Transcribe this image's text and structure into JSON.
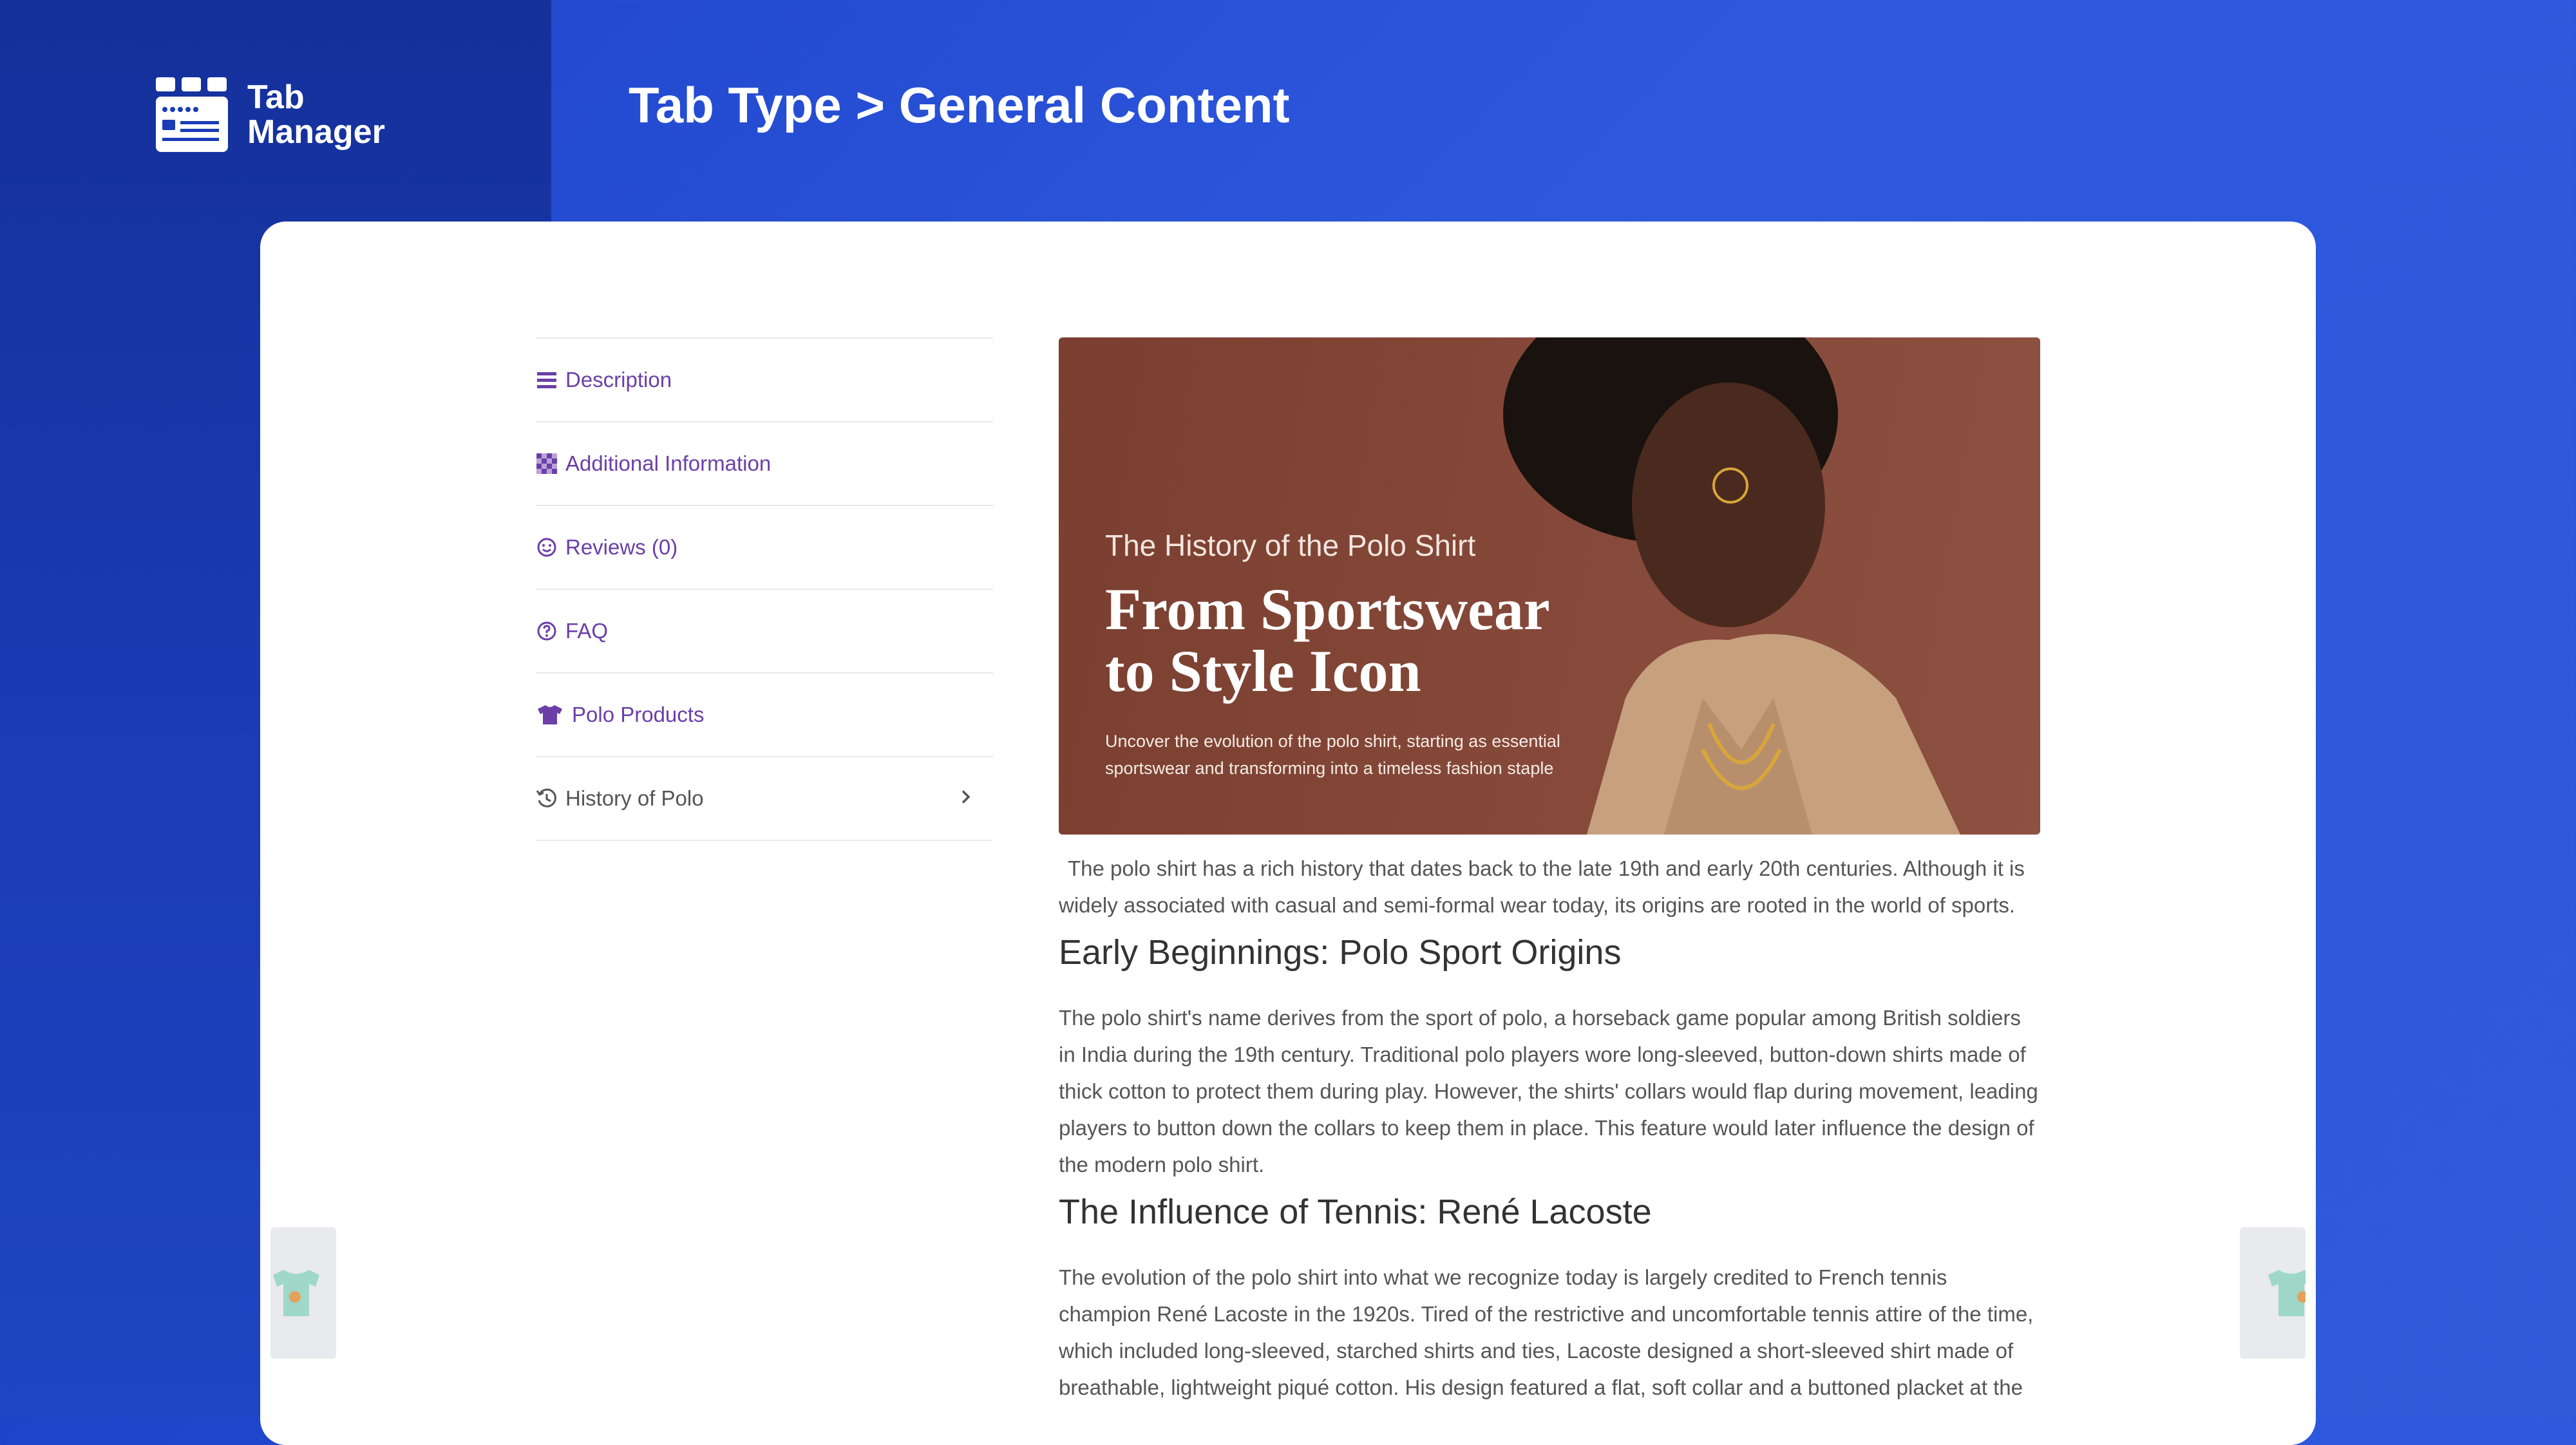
{
  "app": {
    "logo_line1": "Tab",
    "logo_line2": "Manager",
    "page_title": "Tab Type > General Content"
  },
  "tabs": [
    {
      "label": "Description",
      "icon": "list-icon"
    },
    {
      "label": "Additional Information",
      "icon": "grid-pattern-icon"
    },
    {
      "label": "Reviews (0)",
      "icon": "smiley-icon"
    },
    {
      "label": "FAQ",
      "icon": "question-circle-icon"
    },
    {
      "label": "Polo Products",
      "icon": "tshirt-icon"
    },
    {
      "label": "History of Polo",
      "icon": "history-icon",
      "active": true
    }
  ],
  "banner": {
    "kicker": "The History of the Polo Shirt",
    "headline": "From Sportswear to Style Icon",
    "subtext": "Uncover the evolution of the polo shirt, starting as essential sportswear and transforming into a timeless fashion staple"
  },
  "article": {
    "intro": "The polo shirt has a rich history that dates back to the late 19th and early 20th centuries. Although it is widely associated with casual and semi-formal wear today, its origins are rooted in the world of sports.",
    "h1": "Early Beginnings: Polo Sport Origins",
    "p1": "The polo shirt's name derives from the sport of polo, a horseback game popular among British soldiers in India during the 19th century. Traditional polo players wore long-sleeved, button-down shirts made of thick cotton to protect them during play. However, the shirts' collars would flap during movement, leading players to button down the collars to keep them in place. This feature would later influence the design of the modern polo shirt.",
    "h2": "The Influence of Tennis: René Lacoste",
    "p2": "The evolution of the polo shirt into what we recognize today is largely credited to French tennis champion René Lacoste in the 1920s. Tired of the restrictive and uncomfortable tennis attire of the time, which included long-sleeved, starched shirts and ties, Lacoste designed a short-sleeved shirt made of breathable, lightweight piqué cotton. His design featured a flat, soft collar and a buttoned placket at the"
  },
  "colors": {
    "accent": "#6b3fa7",
    "header_blue": "#2d58dd",
    "sidebar_dark": "#14309a"
  }
}
